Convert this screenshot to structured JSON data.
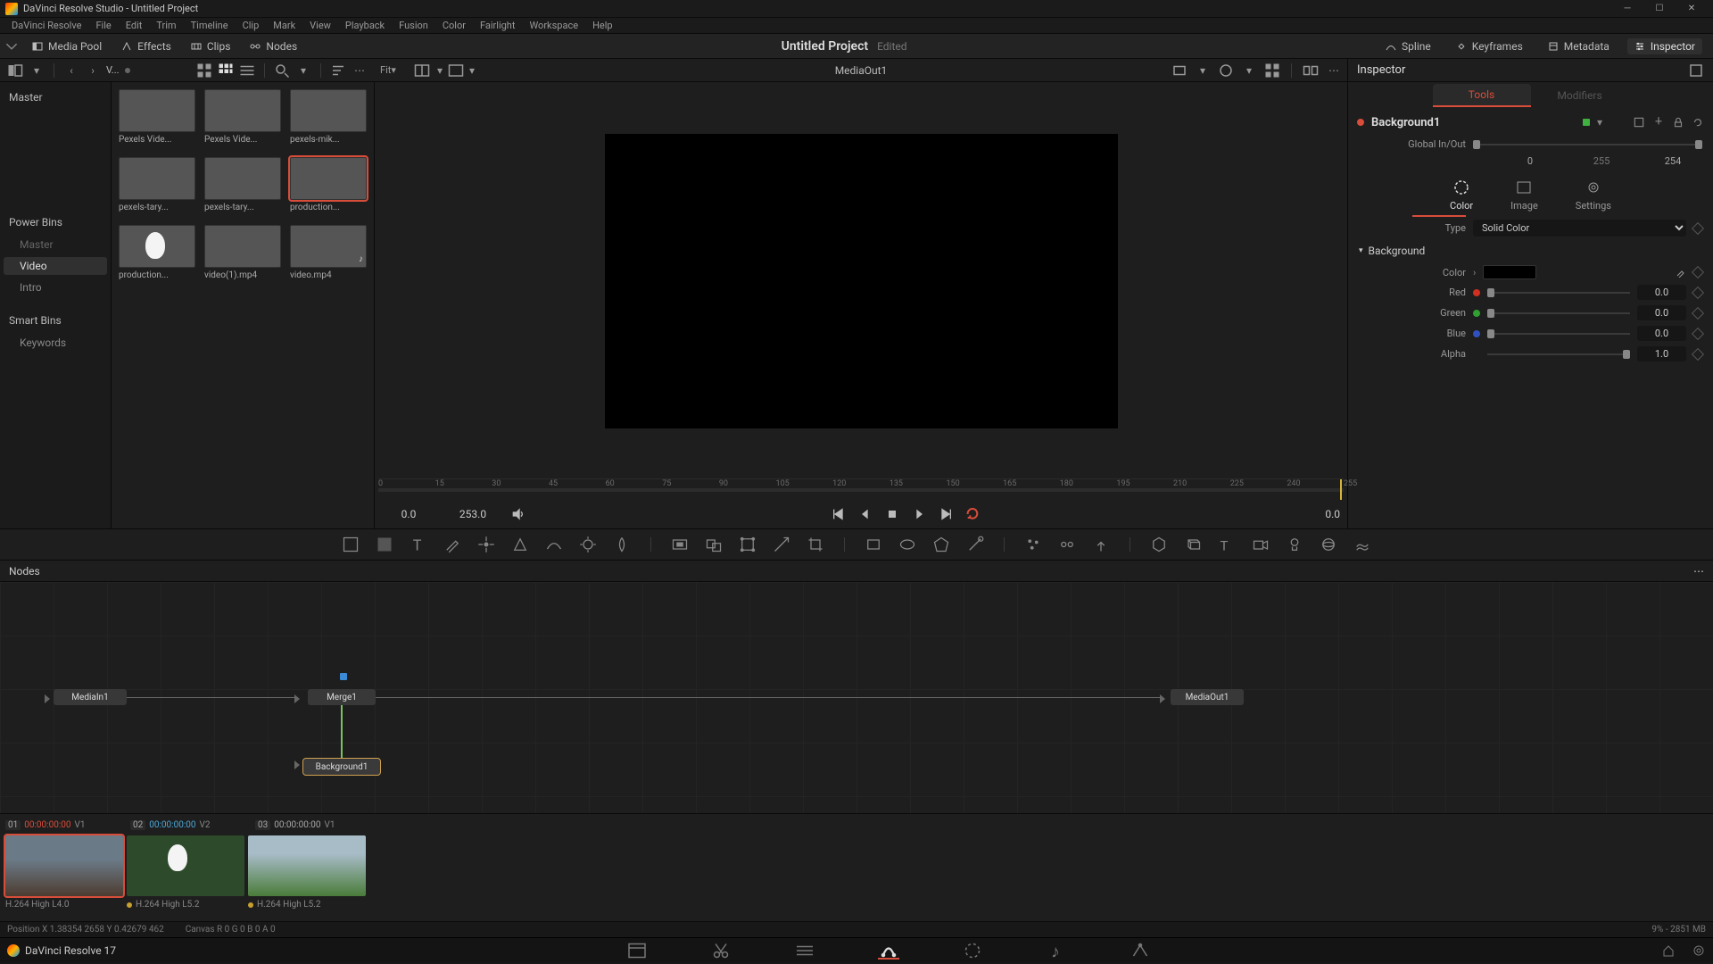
{
  "titlebar": {
    "text": "DaVinci Resolve Studio - Untitled Project"
  },
  "menubar": [
    "DaVinci Resolve",
    "File",
    "Edit",
    "Trim",
    "Timeline",
    "Clip",
    "Mark",
    "View",
    "Playback",
    "Fusion",
    "Color",
    "Fairlight",
    "Workspace",
    "Help"
  ],
  "toptool": {
    "left": [
      {
        "icon": "chevron-down-icon",
        "label": ""
      },
      {
        "icon": "media-pool-icon",
        "label": "Media Pool"
      },
      {
        "icon": "effects-icon",
        "label": "Effects"
      },
      {
        "icon": "clips-icon",
        "label": "Clips"
      },
      {
        "icon": "nodes-icon",
        "label": "Nodes"
      }
    ],
    "project": "Untitled Project",
    "edited": "Edited",
    "right": [
      {
        "icon": "spline-icon",
        "label": "Spline"
      },
      {
        "icon": "keyframes-icon",
        "label": "Keyframes"
      },
      {
        "icon": "metadata-icon",
        "label": "Metadata"
      },
      {
        "icon": "inspector-icon",
        "label": "Inspector",
        "active": true
      }
    ]
  },
  "viewbar": {
    "sort_label": "V...",
    "fit_label": "Fit",
    "viewer_title": "MediaOut1",
    "inspector_title": "Inspector"
  },
  "bins": {
    "master": "Master",
    "power": "Power Bins",
    "power_items": [
      "Master",
      "Video",
      "Intro"
    ],
    "smart": "Smart Bins",
    "smart_items": [
      "Keywords"
    ]
  },
  "clips": [
    {
      "label": "Pexels Vide...",
      "cls": "thumb-sky"
    },
    {
      "label": "Pexels Vide...",
      "cls": "thumb-bw"
    },
    {
      "label": "pexels-mik...",
      "cls": "thumb-field"
    },
    {
      "label": "pexels-tary...",
      "cls": "thumb-dog1"
    },
    {
      "label": "pexels-tary...",
      "cls": "thumb-dog2"
    },
    {
      "label": "production...",
      "cls": "thumb-green",
      "sel": true
    },
    {
      "label": "production...",
      "cls": "thumb-rabbit"
    },
    {
      "label": "video(1).mp4",
      "cls": "thumb-face"
    },
    {
      "label": "video.mp4",
      "cls": "thumb-vid"
    }
  ],
  "ruler_ticks": [
    "0",
    "15",
    "30",
    "45",
    "60",
    "75",
    "90",
    "105",
    "120",
    "135",
    "150",
    "165",
    "180",
    "195",
    "210",
    "225",
    "240",
    "255"
  ],
  "transport": {
    "cur": "0.0",
    "end": "253.0",
    "right": "0.0"
  },
  "inspector": {
    "tabs": {
      "tools": "Tools",
      "modifiers": "Modifiers"
    },
    "node_name": "Background1",
    "global": {
      "label": "Global In/Out",
      "in": "0",
      "mid": "255",
      "out": "254"
    },
    "icons": [
      {
        "l": "Color",
        "a": true
      },
      {
        "l": "Image"
      },
      {
        "l": "Settings"
      }
    ],
    "type": {
      "label": "Type",
      "value": "Solid Color"
    },
    "section": "Background",
    "color": {
      "label": "Color"
    },
    "channels": [
      {
        "label": "Red",
        "dot": "dot-red",
        "val": "0.0"
      },
      {
        "label": "Green",
        "dot": "dot-green",
        "val": "0.0"
      },
      {
        "label": "Blue",
        "dot": "dot-blue",
        "val": "0.0"
      },
      {
        "label": "Alpha",
        "dot": "",
        "val": "1.0"
      }
    ]
  },
  "nodes_header": "Nodes",
  "flow_nodes": {
    "mediain": "MediaIn1",
    "merge": "Merge1",
    "bg": "Background1",
    "out": "MediaOut1"
  },
  "clipstrip": {
    "items": [
      {
        "idx": "01",
        "tc": "00:00:00:00",
        "tc_cls": "tc-red",
        "v": "V1",
        "thumb": "thumb-sky",
        "sel": true,
        "codec": "H.264 High L4.0"
      },
      {
        "idx": "02",
        "tc": "00:00:00:00",
        "tc_cls": "tc-blue",
        "v": "V2",
        "thumb": "thumb-rabbit",
        "codec": "H.264 High L5.2"
      },
      {
        "idx": "03",
        "tc": "00:00:00:00",
        "tc_cls": "",
        "v": "V1",
        "thumb": "thumb-green",
        "codec": "H.264 High L5.2"
      }
    ]
  },
  "status": {
    "pos": "Position   X 1.38354   2658   Y 0.42679   462",
    "canvas": "Canvas  R 0        G 0        B 0        A 0",
    "right": "9% - 2851 MB"
  },
  "pagenav": {
    "app": "DaVinci Resolve 17"
  }
}
